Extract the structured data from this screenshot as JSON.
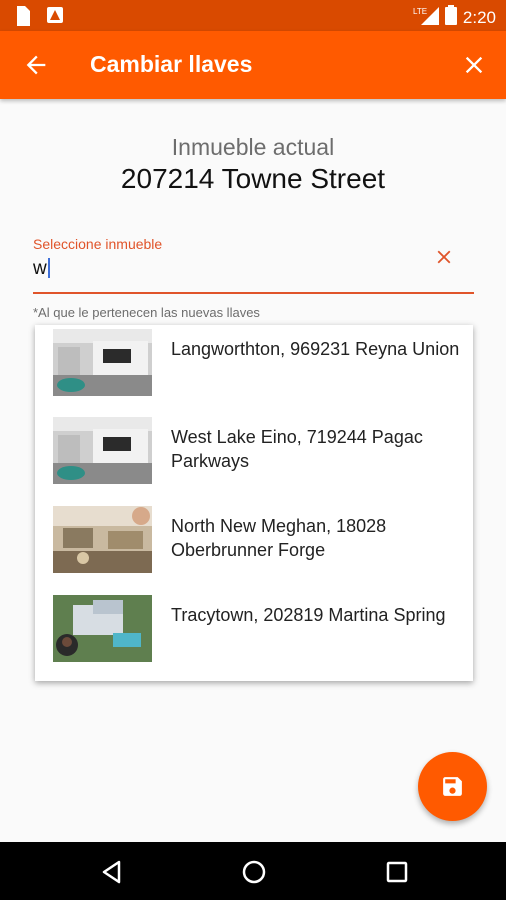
{
  "status_bar": {
    "time": "2:20",
    "icons": [
      "sim-card-icon",
      "alert-icon",
      "lte-signal-icon",
      "battery-icon"
    ],
    "network": "LTE"
  },
  "app_bar": {
    "title": "Cambiar llaves",
    "back_icon": "arrow-back-icon",
    "close_icon": "close-icon"
  },
  "current_property": {
    "label": "Inmueble actual",
    "value": "207214 Towne Street"
  },
  "property_select": {
    "label": "Seleccione inmueble",
    "value": "w",
    "hint": "*Al que le pertenecen las nuevas llaves",
    "clear_icon": "close-icon"
  },
  "options": [
    {
      "text": "Langworthton, 969231 Reyna Union",
      "image": "living-room-photo"
    },
    {
      "text": "West Lake Eino, 719244 Pagac Parkways",
      "image": "living-room-photo"
    },
    {
      "text": "North New Meghan, 18028 Oberbrunner Forge",
      "image": "lounge-photo"
    },
    {
      "text": "Tracytown, 202819 Martina Spring",
      "image": "house-aerial-photo"
    }
  ],
  "fab": {
    "icon": "save-icon"
  },
  "nav_bar": {
    "icons": [
      "back-triangle-icon",
      "home-circle-icon",
      "recents-square-icon"
    ]
  },
  "colors": {
    "primary": "#ff5a00",
    "status_bar": "#d94a00",
    "accent": "#e0542a"
  }
}
